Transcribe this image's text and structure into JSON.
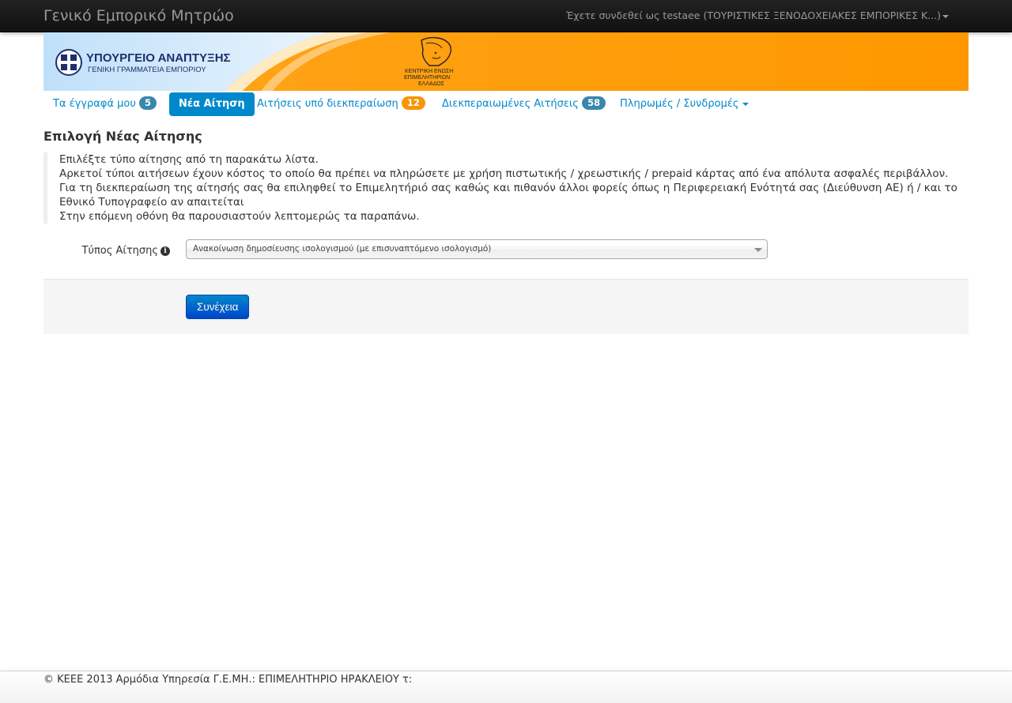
{
  "navbar": {
    "brand": "Γενικό Εμπορικό Μητρώο",
    "user_text": "Έχετε συνδεθεί ως testaee (ΤΟΥΡΙΣΤΙΚΕΣ ΞΕΝΟΔΟΧΕΙΑΚΕΣ ΕΜΠΟΡΙΚΕΣ Κ...)"
  },
  "banner": {
    "ministry_line1": "ΥΠΟΥΡΓΕΙΟ ΑΝΑΠΤΥΞΗΣ",
    "ministry_line2": "ΓΕΝΙΚΗ ΓΡΑΜΜΑΤΕΙΑ ΕΜΠΟΡΙΟΥ",
    "chamber_line1": "ΚΕΝΤΡΙΚΗ ΕΝΩΣΗ",
    "chamber_line2": "ΕΠΙΜΕΛΗΤΗΡΙΩΝ",
    "chamber_line3": "ΕΛΛΑΔΟΣ",
    "colors": {
      "orange": "#ff9c00",
      "sky": "#cfe8fb",
      "navy": "#1f2f6b"
    }
  },
  "tabs": {
    "my_documents": {
      "label": "Τα έγγραφά μου",
      "count": "5"
    },
    "new_application": {
      "label": "Νέα Αίτηση"
    },
    "pending": {
      "label": "Αιτήσεις υπό διεκπεραίωση",
      "count": "12"
    },
    "completed": {
      "label": "Διεκπεραιωμένες Αιτήσεις",
      "count": "58"
    },
    "payments": {
      "label": "Πληρωμές / Συνδρομές"
    }
  },
  "page": {
    "title": "Επιλογή Νέας Αίτησης",
    "info_lines": [
      "Επιλέξτε τύπο αίτησης από τη παρακάτω λίστα.",
      "Αρκετοί τύποι αιτήσεων έχουν κόστος το οποίο θα πρέπει να πληρώσετε με χρήση πιστωτικής / χρεωστικής / prepaid κάρτας από ένα απόλυτα ασφαλές περιβάλλον.",
      "Για τη διεκπεραίωση της αίτησής σας θα επιληφθεί το Επιμελητήριό σας καθώς και πιθανόν άλλοι φορείς όπως η Περιφερειακή Ενότητά σας (Διεύθυνση ΑΕ) ή / και το Εθνικό Τυπογραφείο αν απαιτείται",
      "Στην επόμενη οθόνη θα παρουσιαστούν λεπτομερώς τα παραπάνω."
    ]
  },
  "form": {
    "type_label": "Τύπος Αίτησης",
    "type_value": "Ανακοίνωση δημοσίευσης ισολογισμού (με επισυναπτόμενο ισολογισμό)",
    "submit_label": "Συνέχεια"
  },
  "footer": {
    "text": "© ΚΕΕΕ 2013 Αρμόδια Υπηρεσία Γ.Ε.ΜΗ.: ΕΠΙΜΕΛΗΤΗΡΙΟ ΗΡΑΚΛΕΙΟΥ τ:"
  }
}
